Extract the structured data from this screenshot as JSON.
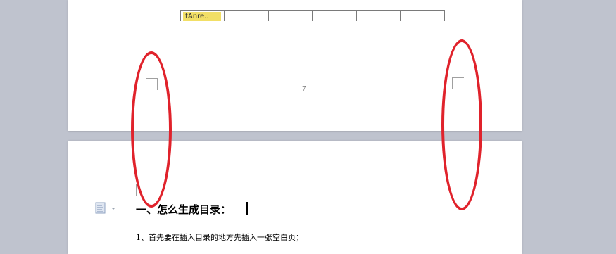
{
  "document": {
    "page1": {
      "table_cell_text": "tAnre..",
      "page_number": "7"
    },
    "page2": {
      "heading": "一、怎么生成目录：",
      "paragraph": "1、首先要在插入目录的地方先插入一张空白页；"
    }
  },
  "colors": {
    "background": "#bfc3ce",
    "page": "#ffffff",
    "annotation": "#e0222b",
    "highlight": "#f2df66"
  },
  "icons": [
    "paste-options-icon",
    "chevron-down-icon"
  ]
}
